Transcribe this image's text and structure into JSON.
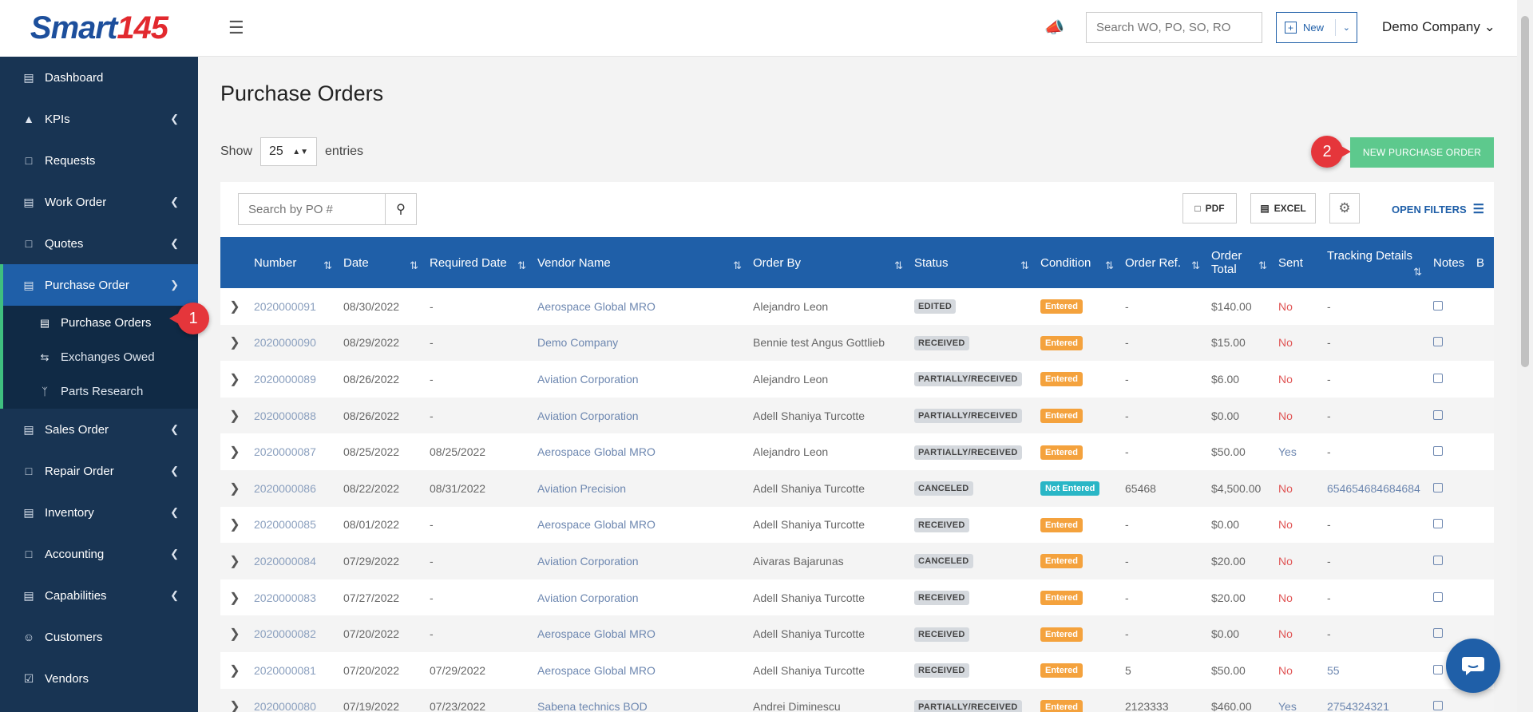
{
  "logo": {
    "text": "Smart",
    "num": "145"
  },
  "sidebar": {
    "items": [
      {
        "label": "Dashboard",
        "icon": "chart-bar-icon"
      },
      {
        "label": "KPIs",
        "icon": "chart-line-icon"
      },
      {
        "label": "Requests",
        "icon": "document-icon"
      },
      {
        "label": "Work Order",
        "icon": "list-icon"
      },
      {
        "label": "Quotes",
        "icon": "clipboard-icon"
      },
      {
        "label": "Purchase Order",
        "icon": "cart-icon"
      },
      {
        "label": "Sales Order",
        "icon": "card-icon"
      },
      {
        "label": "Repair Order",
        "icon": "wrench-icon"
      },
      {
        "label": "Inventory",
        "icon": "box-icon"
      },
      {
        "label": "Accounting",
        "icon": "calculator-icon"
      },
      {
        "label": "Capabilities",
        "icon": "stack-icon"
      },
      {
        "label": "Customers",
        "icon": "users-icon"
      },
      {
        "label": "Vendors",
        "icon": "check-square-icon"
      }
    ],
    "subitems": [
      {
        "label": "Purchase Orders",
        "icon": "cart-icon"
      },
      {
        "label": "Exchanges Owed",
        "icon": "exchange-icon"
      },
      {
        "label": "Parts Research",
        "icon": "branch-icon"
      }
    ]
  },
  "header": {
    "search_placeholder": "Search WO, PO, SO, RO",
    "new_label": "New",
    "company": "Demo Company"
  },
  "main": {
    "title": "Purchase Orders",
    "show_label": "Show",
    "entries_value": "25",
    "entries_label": "entries",
    "new_po_label": "NEW PURCHASE ORDER",
    "search_placeholder": "Search by PO #",
    "pdf_label": "PDF",
    "excel_label": "EXCEL",
    "open_filters_label": "OPEN FILTERS",
    "badge1": "1",
    "badge2": "2"
  },
  "table": {
    "columns": [
      "Number",
      "Date",
      "Required Date",
      "Vendor Name",
      "Order By",
      "Status",
      "Condition",
      "Order Ref.",
      "Order Total",
      "Sent",
      "Tracking Details",
      "Notes",
      "B"
    ],
    "rows": [
      {
        "number": "2020000091",
        "date": "08/30/2022",
        "required": "-",
        "vendor": "Aerospace Global MRO",
        "order_by": "Alejandro Leon",
        "status": "EDITED",
        "condition": "Entered",
        "ref": "-",
        "total": "$140.00",
        "sent": "No",
        "tracking": "-"
      },
      {
        "number": "2020000090",
        "date": "08/29/2022",
        "required": "-",
        "vendor": "Demo Company",
        "order_by": "Bennie test Angus Gottlieb",
        "status": "RECEIVED",
        "condition": "Entered",
        "ref": "-",
        "total": "$15.00",
        "sent": "No",
        "tracking": "-"
      },
      {
        "number": "2020000089",
        "date": "08/26/2022",
        "required": "-",
        "vendor": "Aviation Corporation",
        "order_by": "Alejandro Leon",
        "status": "PARTIALLY/RECEIVED",
        "condition": "Entered",
        "ref": "-",
        "total": "$6.00",
        "sent": "No",
        "tracking": "-"
      },
      {
        "number": "2020000088",
        "date": "08/26/2022",
        "required": "-",
        "vendor": "Aviation Corporation",
        "order_by": "Adell Shaniya Turcotte",
        "status": "PARTIALLY/RECEIVED",
        "condition": "Entered",
        "ref": "-",
        "total": "$0.00",
        "sent": "No",
        "tracking": "-"
      },
      {
        "number": "2020000087",
        "date": "08/25/2022",
        "required": "08/25/2022",
        "vendor": "Aerospace Global MRO",
        "order_by": "Alejandro Leon",
        "status": "PARTIALLY/RECEIVED",
        "condition": "Entered",
        "ref": "-",
        "total": "$50.00",
        "sent": "Yes",
        "tracking": "-"
      },
      {
        "number": "2020000086",
        "date": "08/22/2022",
        "required": "08/31/2022",
        "vendor": "Aviation Precision",
        "order_by": "Adell Shaniya Turcotte",
        "status": "CANCELED",
        "condition": "Not Entered",
        "ref": "65468",
        "total": "$4,500.00",
        "sent": "No",
        "tracking": "654654684684684"
      },
      {
        "number": "2020000085",
        "date": "08/01/2022",
        "required": "-",
        "vendor": "Aerospace Global MRO",
        "order_by": "Adell Shaniya Turcotte",
        "status": "RECEIVED",
        "condition": "Entered",
        "ref": "-",
        "total": "$0.00",
        "sent": "No",
        "tracking": "-"
      },
      {
        "number": "2020000084",
        "date": "07/29/2022",
        "required": "-",
        "vendor": "Aviation Corporation",
        "order_by": "Aivaras Bajarunas",
        "status": "CANCELED",
        "condition": "Entered",
        "ref": "-",
        "total": "$20.00",
        "sent": "No",
        "tracking": "-"
      },
      {
        "number": "2020000083",
        "date": "07/27/2022",
        "required": "-",
        "vendor": "Aviation Corporation",
        "order_by": "Adell Shaniya Turcotte",
        "status": "RECEIVED",
        "condition": "Entered",
        "ref": "-",
        "total": "$20.00",
        "sent": "No",
        "tracking": "-"
      },
      {
        "number": "2020000082",
        "date": "07/20/2022",
        "required": "-",
        "vendor": "Aerospace Global MRO",
        "order_by": "Adell Shaniya Turcotte",
        "status": "RECEIVED",
        "condition": "Entered",
        "ref": "-",
        "total": "$0.00",
        "sent": "No",
        "tracking": "-"
      },
      {
        "number": "2020000081",
        "date": "07/20/2022",
        "required": "07/29/2022",
        "vendor": "Aerospace Global MRO",
        "order_by": "Adell Shaniya Turcotte",
        "status": "RECEIVED",
        "condition": "Entered",
        "ref": "5",
        "total": "$50.00",
        "sent": "No",
        "tracking": "55"
      },
      {
        "number": "2020000080",
        "date": "07/19/2022",
        "required": "07/23/2022",
        "vendor": "Sabena technics BOD",
        "order_by": "Andrei Diminescu",
        "status": "PARTIALLY/RECEIVED",
        "condition": "Entered",
        "ref": "2123333",
        "total": "$460.00",
        "sent": "Yes",
        "tracking": "2754324321"
      }
    ]
  }
}
